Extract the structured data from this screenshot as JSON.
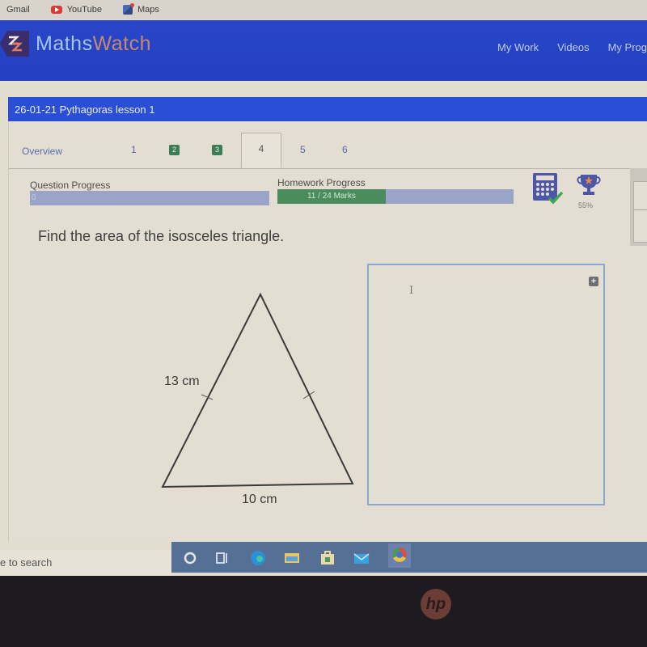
{
  "browser": {
    "bookmarks": [
      {
        "label": "Gmail",
        "icon": "gmail-icon"
      },
      {
        "label": "YouTube",
        "icon": "youtube-icon"
      },
      {
        "label": "Maps",
        "icon": "maps-icon"
      }
    ]
  },
  "header": {
    "logo_part1": "Maths",
    "logo_part2": "Watch",
    "nav": [
      "My Work",
      "Videos",
      "My Prog"
    ],
    "colors": {
      "bar": "#2340c1",
      "logo_maths": "#a7c4f2",
      "logo_watch": "#c58a6e"
    }
  },
  "lesson": {
    "title": "26-01-21 Pythagoras lesson 1"
  },
  "tabs": {
    "overview": "Overview",
    "items": [
      {
        "label": "1",
        "status": "pending"
      },
      {
        "label": "2",
        "status": "completed"
      },
      {
        "label": "3",
        "status": "completed"
      },
      {
        "label": "4",
        "status": "active"
      },
      {
        "label": "5",
        "status": "pending"
      },
      {
        "label": "6",
        "status": "pending"
      }
    ]
  },
  "progress": {
    "question_label": "Question Progress",
    "question_value_text": "0",
    "question_fraction": 0,
    "homework_label": "Homework Progress",
    "homework_text": "11 / 24 Marks",
    "homework_marks": 11,
    "homework_total": 24,
    "trophy_percent": "55%",
    "colors": {
      "fill": "#4a8c5c",
      "track": "#9aa4c9"
    }
  },
  "question": {
    "text": "Find the area of the isosceles triangle.",
    "side_label": "13 cm",
    "base_label": "10 cm"
  },
  "answer": {
    "add_label": "+"
  },
  "taskbar": {
    "search_text": "e to search",
    "apps": [
      "cortana-icon",
      "task-view-icon",
      "edge-icon",
      "file-explorer-icon",
      "store-icon",
      "mail-icon",
      "chrome-icon"
    ]
  },
  "device": {
    "brand": "hp"
  }
}
